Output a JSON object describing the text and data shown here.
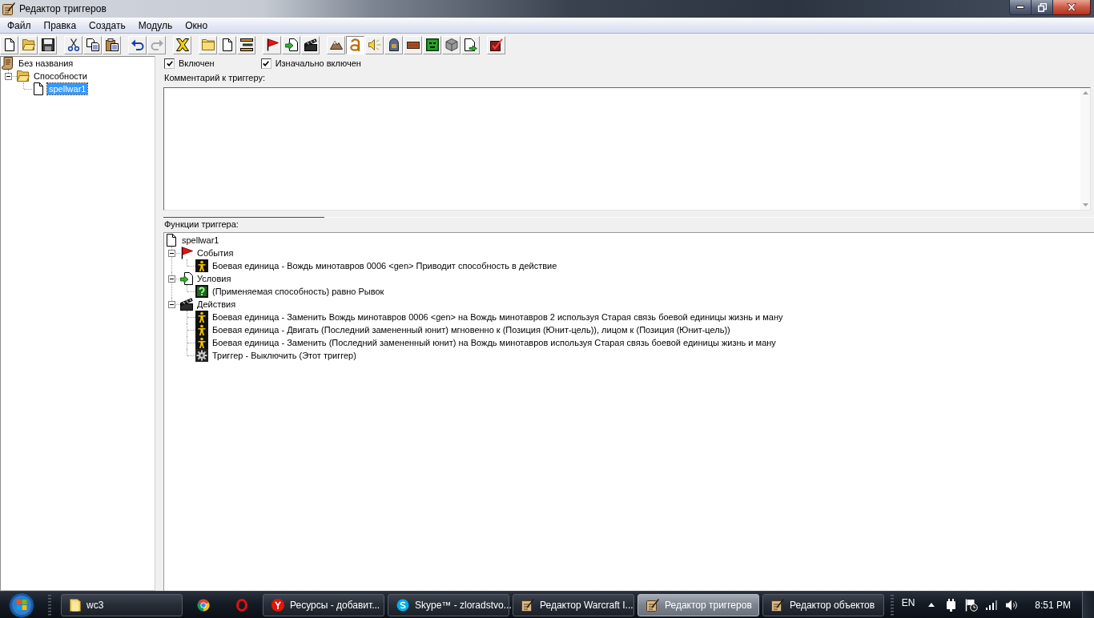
{
  "window": {
    "title": "Редактор триггеров"
  },
  "menu": [
    "Файл",
    "Правка",
    "Создать",
    "Модуль",
    "Окно"
  ],
  "toolbar": [
    [
      {
        "pressed": false,
        "disabled": false
      },
      {
        "pressed": false,
        "disabled": false
      },
      {
        "pressed": false,
        "disabled": false
      }
    ],
    [
      {
        "pressed": false,
        "disabled": false
      },
      {
        "pressed": false,
        "disabled": false
      },
      {
        "pressed": false,
        "disabled": false
      }
    ],
    [
      {
        "pressed": false,
        "disabled": false
      },
      {
        "pressed": false,
        "disabled": true
      }
    ],
    [
      {
        "pressed": false,
        "disabled": false
      }
    ],
    [
      {
        "pressed": false,
        "disabled": false
      },
      {
        "pressed": false,
        "disabled": false
      },
      {
        "pressed": false,
        "disabled": false
      }
    ],
    [
      {
        "pressed": false,
        "disabled": false
      },
      {
        "pressed": false,
        "disabled": false
      },
      {
        "pressed": false,
        "disabled": false
      }
    ],
    [
      {
        "pressed": false,
        "disabled": false
      },
      {
        "pressed": true,
        "disabled": false
      },
      {
        "pressed": false,
        "disabled": false
      },
      {
        "pressed": false,
        "disabled": false
      },
      {
        "pressed": false,
        "disabled": false
      },
      {
        "pressed": false,
        "disabled": false
      },
      {
        "pressed": false,
        "disabled": false
      },
      {
        "pressed": false,
        "disabled": false
      }
    ],
    [
      {
        "pressed": false,
        "disabled": false
      }
    ]
  ],
  "trigger_list": [
    {
      "kind": "map",
      "label": "Без названия",
      "selected": false,
      "children": [
        {
          "kind": "category",
          "label": "Способности",
          "expanded": true,
          "selected": false,
          "children": [
            {
              "kind": "trigger",
              "label": "spellwar1",
              "selected": true
            }
          ]
        }
      ]
    }
  ],
  "options": [
    {
      "label": "Включен",
      "checked": true
    },
    {
      "label": "Изначально включен",
      "checked": true
    }
  ],
  "comment": {
    "label": "Комментарий к триггеру:"
  },
  "functions": {
    "label": "Функции триггера:",
    "tree": [
      {
        "kind": "trigger",
        "label": "spellwar1",
        "selected": false,
        "children": [
          {
            "kind": "events",
            "label": "События",
            "expanded": true,
            "selected": false,
            "children": [
              {
                "kind": "unit",
                "label": "Боевая единица - Вождь минотавров 0006 <gen> Приводит способность в действие",
                "selected": false
              }
            ]
          },
          {
            "kind": "conditions",
            "label": "Условия",
            "expanded": true,
            "selected": false,
            "children": [
              {
                "kind": "comparison",
                "label": "(Применяемая способность) равно Рывок",
                "selected": false
              }
            ]
          },
          {
            "kind": "actions",
            "label": "Действия",
            "expanded": true,
            "selected": false,
            "children": [
              {
                "kind": "unit",
                "label": "Боевая единица - Заменить Вождь минотавров 0006 <gen> на Вождь минотавров 2 используя Старая связь боевой единицы жизнь и ману",
                "selected": false
              },
              {
                "kind": "unit",
                "label": "Боевая единица - Двигать (Последний замененный юнит) мгновенно к (Позиция (Юнит-цель)), лицом к (Позиция (Юнит-цель))",
                "selected": false
              },
              {
                "kind": "unit",
                "label": "Боевая единица - Заменить (Последний замененный юнит) на Вождь минотавров используя Старая связь боевой единицы жизнь и ману",
                "selected": false
              },
              {
                "kind": "trigger-control",
                "label": "Триггер - Выключить (Этот триггер)",
                "selected": false
              }
            ]
          }
        ]
      }
    ]
  },
  "taskbar": {
    "items": [
      {
        "kind": "folder",
        "label": "wc3",
        "selected": false
      },
      {
        "kind": "wheel",
        "selected": false
      },
      {
        "kind": "ring",
        "selected": false
      },
      {
        "kind": "badge",
        "label": "Ресурсы - добавит...",
        "selected": false
      },
      {
        "kind": "cloud",
        "label": "Skype™ - zloradstvo...",
        "selected": false
      },
      {
        "kind": "quill",
        "label": "Редактор Warcraft I...",
        "selected": false
      },
      {
        "kind": "quill",
        "label": "Редактор триггеров",
        "selected": true
      },
      {
        "kind": "quill",
        "label": "Редактор объектов",
        "selected": false
      }
    ],
    "language": "EN",
    "time": "8:51 PM"
  }
}
